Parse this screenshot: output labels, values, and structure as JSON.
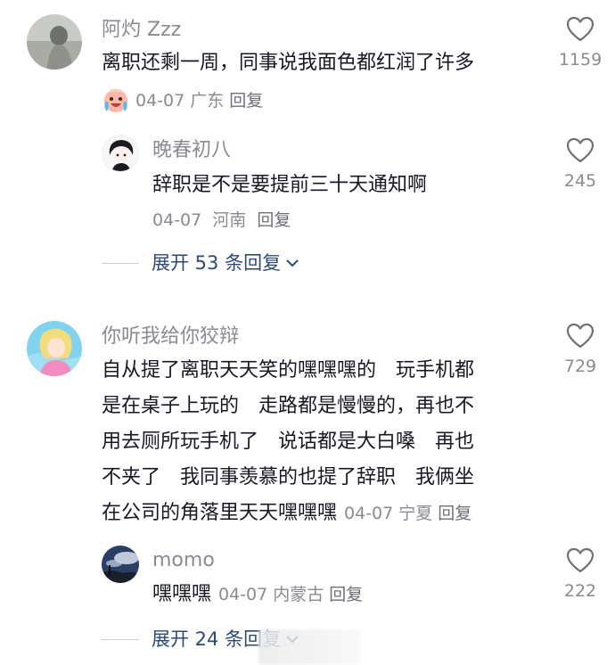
{
  "comments": [
    {
      "username": "阿灼 Zzz",
      "text": "离职还剩一周，同事说我面色都红润了许多",
      "date": "04-07",
      "location": "广东",
      "reply_label": "回复",
      "likes": "1159",
      "badge_icon": "crying-laughing-emoji-icon",
      "replies": [
        {
          "username": "晚春初八",
          "text": "辞职是不是要提前三十天通知啊",
          "date": "04-07",
          "location": "河南",
          "reply_label": "回复",
          "likes": "245"
        }
      ],
      "expand_label": "展开 53 条回复"
    },
    {
      "username": "你听我给你狡辩",
      "text_lines": [
        "自从提了离职天天笑的嘿嘿嘿的　玩手机都",
        "是在桌子上玩的　走路都是慢慢的，再也不",
        "用去厕所玩手机了　说话都是大白嗓　再也",
        "不夹了　我同事羡慕的也提了辞职　我俩坐",
        "在公司的角落里天天嘿嘿嘿"
      ],
      "date": "04-07",
      "location": "宁夏",
      "reply_label": "回复",
      "likes": "729",
      "replies": [
        {
          "username": "momo",
          "text": "嘿嘿嘿",
          "date": "04-07",
          "location": "内蒙古",
          "reply_label": "回复",
          "likes": "222"
        }
      ],
      "expand_label": "展开 24 条回复"
    }
  ],
  "colors": {
    "text_primary": "#161823",
    "text_secondary": "#8a8b91",
    "expand_link": "#2b4a7a"
  }
}
